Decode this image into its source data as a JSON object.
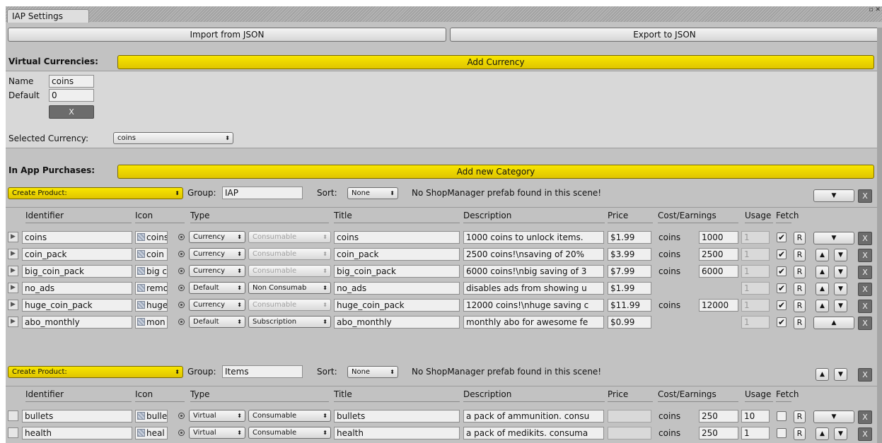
{
  "window": {
    "tab_title": "IAP Settings",
    "controls": "▫ ✕"
  },
  "toolbar": {
    "import_label": "Import from JSON",
    "export_label": "Export to JSON"
  },
  "currencies": {
    "heading": "Virtual Currencies:",
    "add_label": "Add Currency",
    "name_label": "Name",
    "name_value": "coins",
    "default_label": "Default",
    "default_value": "0",
    "remove_label": "X",
    "selected_label": "Selected Currency:",
    "selected_value": "coins"
  },
  "iap": {
    "heading": "In App Purchases:",
    "add_category_label": "Add new Category"
  },
  "headers": {
    "identifier": "Identifier",
    "icon": "Icon",
    "type": "Type",
    "title": "Title",
    "description": "Description",
    "price": "Price",
    "cost": "Cost/Earnings",
    "usage": "Usage",
    "fetch": "Fetch"
  },
  "categories": [
    {
      "create_label": "Create Product:",
      "group_label": "Group:",
      "group_value": "IAP",
      "sort_label": "Sort:",
      "sort_value": "None",
      "notice": "No ShopManager prefab found in this scene!",
      "products": [
        {
          "id": "coins",
          "icon": "coins",
          "type": "Currency",
          "kind": "Consumable",
          "title": "coins",
          "description": "1000 coins to unlock items.",
          "price": "$1.99",
          "currency": "coins",
          "amount": "1000",
          "usage": "1",
          "fetch": true
        },
        {
          "id": "coin_pack",
          "icon": "coin",
          "type": "Currency",
          "kind": "Consumable",
          "title": "coin_pack",
          "description": "2500 coins!\\nsaving of 20%",
          "price": "$3.99",
          "currency": "coins",
          "amount": "2500",
          "usage": "1",
          "fetch": true
        },
        {
          "id": "big_coin_pack",
          "icon": "big c",
          "type": "Currency",
          "kind": "Consumable",
          "title": "big_coin_pack",
          "description": "6000 coins!\\nbig saving of 3",
          "price": "$7.99",
          "currency": "coins",
          "amount": "6000",
          "usage": "1",
          "fetch": true
        },
        {
          "id": "no_ads",
          "icon": "remo",
          "type": "Default",
          "kind": "Non Consumab",
          "title": "no_ads",
          "description": "disables ads from showing u",
          "price": "$1.99",
          "currency": "",
          "amount": "",
          "usage": "1",
          "fetch": true
        },
        {
          "id": "huge_coin_pack",
          "icon": "huge",
          "type": "Currency",
          "kind": "Consumable",
          "title": "huge_coin_pack",
          "description": "12000 coins!\\nhuge saving c",
          "price": "$11.99",
          "currency": "coins",
          "amount": "12000",
          "usage": "1",
          "fetch": true
        },
        {
          "id": "abo_monthly",
          "icon": "mon",
          "type": "Default",
          "kind": "Subscription",
          "title": "abo_monthly",
          "description": "monthly abo for awesome fe",
          "price": "$0.99",
          "currency": "",
          "amount": "",
          "usage": "1",
          "fetch": true
        }
      ]
    },
    {
      "create_label": "Create Product:",
      "group_label": "Group:",
      "group_value": "Items",
      "sort_label": "Sort:",
      "sort_value": "None",
      "notice": "No ShopManager prefab found in this scene!",
      "products": [
        {
          "id": "bullets",
          "icon": "bulle",
          "type": "Virtual",
          "kind": "Consumable",
          "title": "bullets",
          "description": "a pack of ammunition. consu",
          "price": "",
          "currency": "coins",
          "amount": "250",
          "usage": "10",
          "fetch": false
        },
        {
          "id": "health",
          "icon": "heal",
          "type": "Virtual",
          "kind": "Consumable",
          "title": "health",
          "description": "a pack of medikits. consuma",
          "price": "",
          "currency": "coins",
          "amount": "250",
          "usage": "1",
          "fetch": false
        }
      ]
    }
  ],
  "glyphs": {
    "up": "▲",
    "down": "▼",
    "close": "X",
    "refresh": "R",
    "check": "✔",
    "fold": "▶",
    "popup_arrow": "⬍"
  }
}
